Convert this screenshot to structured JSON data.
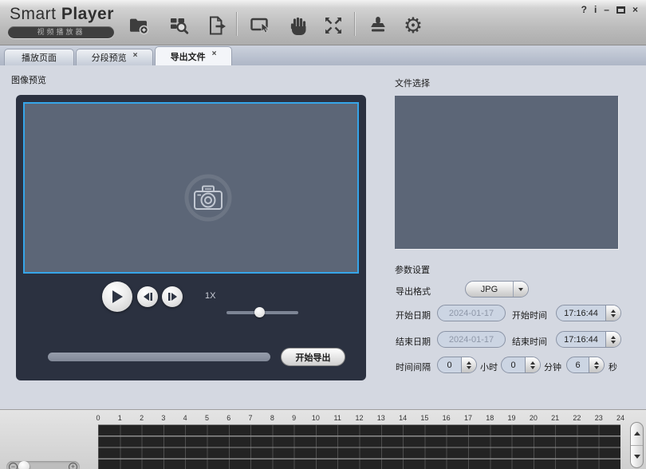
{
  "window": {
    "brand_main": "Smart ",
    "brand_bold": "Player",
    "brand_sub": "视频播放器",
    "controls": {
      "help": "?",
      "info": "i",
      "minimize": "–",
      "close": "×"
    }
  },
  "toolbar": {
    "icons": [
      {
        "name": "open-folder-icon"
      },
      {
        "name": "search-files-icon"
      },
      {
        "name": "export-file-icon"
      },
      {
        "name": "select-region-icon"
      },
      {
        "name": "hand-pan-icon"
      },
      {
        "name": "fullscreen-icon"
      },
      {
        "name": "watermark-stamp-icon"
      },
      {
        "name": "settings-gear-icon"
      }
    ],
    "gear_glyph": "⚙"
  },
  "tabs": [
    {
      "label": "播放页面",
      "closable": false,
      "active": false
    },
    {
      "label": "分段预览",
      "closable": true,
      "active": false
    },
    {
      "label": "导出文件",
      "closable": true,
      "active": true
    }
  ],
  "tab_close_glyph": "×",
  "left_panel": {
    "section_label": "图像预览",
    "speed_label": "1X",
    "export_button": "开始导出"
  },
  "right_panel": {
    "file_section_label": "文件选择",
    "params_section_label": "参数设置",
    "format_label": "导出格式",
    "format_value": "JPG",
    "start_date_label": "开始日期",
    "start_date": "2024-01-17",
    "start_time_label": "开始时间",
    "start_time": "17:16:44",
    "end_date_label": "结束日期",
    "end_date": "2024-01-17",
    "end_time_label": "结束时间",
    "end_time": "17:16:44",
    "interval_label": "时间间隔",
    "interval_hours": "0",
    "hours_unit": "小时",
    "interval_minutes": "0",
    "minutes_unit": "分钟",
    "interval_seconds": "6",
    "seconds_unit": "秒"
  },
  "timeline": {
    "hours": [
      "0",
      "1",
      "2",
      "3",
      "4",
      "5",
      "6",
      "7",
      "8",
      "9",
      "10",
      "11",
      "12",
      "13",
      "14",
      "15",
      "16",
      "17",
      "18",
      "19",
      "20",
      "21",
      "22",
      "23",
      "24"
    ]
  },
  "colors": {
    "accent_blue_border": "#36a5e9",
    "panel_dark": "#2b3140",
    "surface_gray_blue": "#5c6677",
    "input_fill": "#ccd5e3",
    "content_bg": "#d4d8e1",
    "grid_bg": "#232323"
  }
}
